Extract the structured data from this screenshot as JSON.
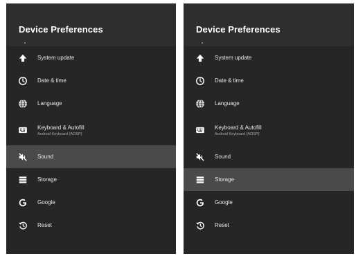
{
  "screens": [
    {
      "title": "Device Preferences",
      "selected_index": 4,
      "items": [
        {
          "label": "System update",
          "icon": "arrow-up-icon"
        },
        {
          "label": "Date & time",
          "icon": "clock-icon"
        },
        {
          "label": "Language",
          "icon": "globe-icon"
        },
        {
          "label": "Keyboard & Autofill",
          "sublabel": "Android Keyboard (AOSP)",
          "icon": "keyboard-icon"
        },
        {
          "label": "Sound",
          "icon": "volume-off-icon"
        },
        {
          "label": "Storage",
          "icon": "storage-icon"
        },
        {
          "label": "Google",
          "icon": "google-icon"
        },
        {
          "label": "Reset",
          "icon": "reset-icon"
        }
      ]
    },
    {
      "title": "Device Preferences",
      "selected_index": 5,
      "items": [
        {
          "label": "System update",
          "icon": "arrow-up-icon"
        },
        {
          "label": "Date & time",
          "icon": "clock-icon"
        },
        {
          "label": "Language",
          "icon": "globe-icon"
        },
        {
          "label": "Keyboard & Autofill",
          "sublabel": "Android Keyboard (AOSP)",
          "icon": "keyboard-icon"
        },
        {
          "label": "Sound",
          "icon": "volume-off-icon"
        },
        {
          "label": "Storage",
          "icon": "storage-icon"
        },
        {
          "label": "Google",
          "icon": "google-icon"
        },
        {
          "label": "Reset",
          "icon": "reset-icon"
        }
      ]
    }
  ],
  "colors": {
    "panel_background": "#262626",
    "header_background": "#2e2e2e",
    "selected_row": "#4a4a4a",
    "text_primary": "#e8e8e8",
    "text_secondary": "#a8a8a8"
  }
}
